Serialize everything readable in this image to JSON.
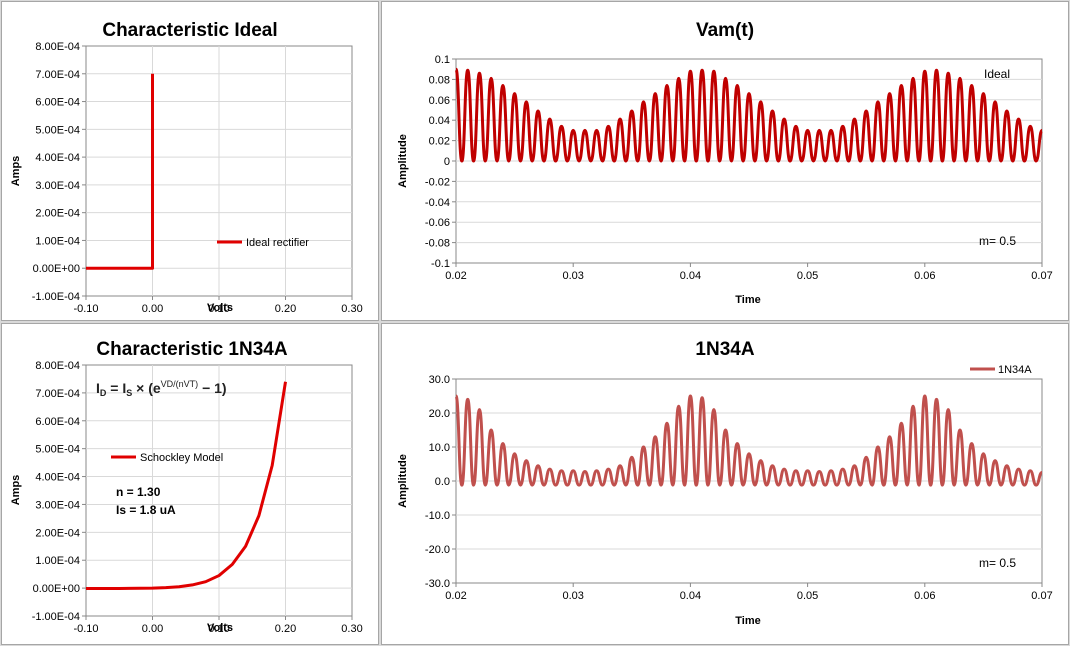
{
  "chart_data": [
    {
      "type": "line",
      "title": "Characteristic Ideal",
      "xlabel": "Volts",
      "ylabel": "Amps",
      "xlim": [
        -0.1,
        0.3
      ],
      "ylim": [
        -0.0001,
        0.0008
      ],
      "xticks": [
        "-0.10",
        "0.00",
        "0.10",
        "0.20",
        "0.30"
      ],
      "yticks": [
        "-1.00E-04",
        "0.00E+00",
        "1.00E-04",
        "2.00E-04",
        "3.00E-04",
        "4.00E-04",
        "5.00E-04",
        "6.00E-04",
        "7.00E-04",
        "8.00E-04"
      ],
      "legend_position": "bottom-right",
      "series": [
        {
          "name": "Ideal rectifier",
          "color": "#e00000",
          "points": [
            [
              -0.1,
              0
            ],
            [
              0.0,
              0
            ],
            [
              0.0,
              0.0007
            ]
          ]
        }
      ]
    },
    {
      "type": "line",
      "title": "Vam(t)",
      "xlabel": "Time",
      "ylabel": "Amplitude",
      "xlim": [
        0.02,
        0.07
      ],
      "ylim": [
        -0.1,
        0.1
      ],
      "xticks": [
        "0.02",
        "0.03",
        "0.04",
        "0.05",
        "0.06",
        "0.07"
      ],
      "yticks": [
        "-0.1",
        "-0.08",
        "-0.06",
        "-0.04",
        "-0.02",
        "0",
        "0.02",
        "0.04",
        "0.06",
        "0.08",
        "0.1"
      ],
      "annotation": "m= 0.5",
      "legend_position": "top-right",
      "legend_text": "Ideal",
      "carrier_period": 0.001,
      "envelope_period": 0.02,
      "peak_times": [
        0.02,
        0.021,
        0.022,
        0.023,
        0.024,
        0.025,
        0.026,
        0.027,
        0.028,
        0.029,
        0.03,
        0.031,
        0.032,
        0.033,
        0.034,
        0.035,
        0.036,
        0.037,
        0.038,
        0.039,
        0.04,
        0.041,
        0.042,
        0.043,
        0.044,
        0.045,
        0.046,
        0.047,
        0.048,
        0.049,
        0.05,
        0.051,
        0.052,
        0.053,
        0.054,
        0.055,
        0.056,
        0.057,
        0.058,
        0.059,
        0.06,
        0.061,
        0.062,
        0.063,
        0.064,
        0.065,
        0.066,
        0.067,
        0.068,
        0.069,
        0.07
      ],
      "peak_values": [
        0.09,
        0.089,
        0.086,
        0.081,
        0.074,
        0.066,
        0.058,
        0.049,
        0.041,
        0.034,
        0.03,
        0.03,
        0.03,
        0.034,
        0.041,
        0.049,
        0.058,
        0.066,
        0.074,
        0.081,
        0.088,
        0.089,
        0.088,
        0.081,
        0.074,
        0.066,
        0.058,
        0.049,
        0.041,
        0.034,
        0.03,
        0.03,
        0.03,
        0.034,
        0.041,
        0.049,
        0.058,
        0.066,
        0.074,
        0.081,
        0.088,
        0.089,
        0.086,
        0.081,
        0.074,
        0.066,
        0.058,
        0.049,
        0.041,
        0.034,
        0.03
      ],
      "trough_value": 0,
      "series": [
        {
          "name": "Ideal",
          "color": "#c00000"
        }
      ]
    },
    {
      "type": "line",
      "title": "Characteristic 1N34A",
      "xlabel": "Volts",
      "ylabel": "Amps",
      "xlim": [
        -0.1,
        0.3
      ],
      "ylim": [
        -0.0001,
        0.0008
      ],
      "xticks": [
        "-0.10",
        "0.00",
        "0.10",
        "0.20",
        "0.30"
      ],
      "yticks": [
        "-1.00E-04",
        "0.00E+00",
        "1.00E-04",
        "2.00E-04",
        "3.00E-04",
        "4.00E-04",
        "5.00E-04",
        "6.00E-04",
        "7.00E-04",
        "8.00E-04"
      ],
      "legend_position": "left",
      "equation": {
        "lhs": "I",
        "lhs_sub": "D",
        "mid": " =  I",
        "mid_sub": "S",
        "times": " × (e",
        "exp": "VD/(nVT)",
        "tail": " − 1)"
      },
      "params": [
        "n  = 1.30",
        "Is = 1.8 uA"
      ],
      "series": [
        {
          "name": "Schockley Model",
          "color": "#e00000",
          "points": [
            [
              -0.1,
              -1.5e-06
            ],
            [
              -0.05,
              -1.4e-06
            ],
            [
              0.0,
              0
            ],
            [
              0.02,
              1.8e-06
            ],
            [
              0.04,
              5e-06
            ],
            [
              0.06,
              1.15e-05
            ],
            [
              0.08,
              2.3e-05
            ],
            [
              0.1,
              4.5e-05
            ],
            [
              0.12,
              8.5e-05
            ],
            [
              0.14,
              0.00015
            ],
            [
              0.16,
              0.00026
            ],
            [
              0.18,
              0.00044
            ],
            [
              0.2,
              0.00074
            ]
          ]
        }
      ]
    },
    {
      "type": "line",
      "title": "1N34A",
      "xlabel": "Time",
      "ylabel": "Amplitude",
      "xlim": [
        0.02,
        0.07
      ],
      "ylim": [
        -30,
        30
      ],
      "xticks": [
        "0.02",
        "0.03",
        "0.04",
        "0.05",
        "0.06",
        "0.07"
      ],
      "yticks": [
        "-30.0",
        "-20.0",
        "-10.0",
        "0.0",
        "10.0",
        "20.0",
        "30.0"
      ],
      "annotation": "m= 0.5",
      "legend_position": "top-right",
      "peak_times": [
        0.02,
        0.021,
        0.022,
        0.023,
        0.024,
        0.025,
        0.026,
        0.027,
        0.028,
        0.029,
        0.03,
        0.031,
        0.032,
        0.033,
        0.034,
        0.035,
        0.036,
        0.037,
        0.038,
        0.039,
        0.04,
        0.041,
        0.042,
        0.043,
        0.044,
        0.045,
        0.046,
        0.047,
        0.048,
        0.049,
        0.05,
        0.051,
        0.052,
        0.053,
        0.054,
        0.055,
        0.056,
        0.057,
        0.058,
        0.059,
        0.06,
        0.061,
        0.062,
        0.063,
        0.064,
        0.065,
        0.066,
        0.067,
        0.068,
        0.069,
        0.07
      ],
      "peak_values": [
        25,
        24,
        21,
        15,
        11,
        8,
        6,
        4.5,
        3.5,
        3,
        3,
        2.8,
        3,
        3.5,
        4.5,
        7,
        10,
        13,
        17,
        22,
        25,
        24.5,
        21,
        15,
        11,
        8,
        6,
        4.5,
        3.5,
        3,
        3,
        2.8,
        3,
        3.5,
        4.5,
        7,
        10,
        13,
        17,
        22,
        25,
        24,
        21,
        15,
        11,
        8,
        6,
        4.5,
        3.5,
        3,
        2.5
      ],
      "trough_value": -1.2,
      "series": [
        {
          "name": "1N34A",
          "color": "#c0504d"
        }
      ]
    }
  ]
}
